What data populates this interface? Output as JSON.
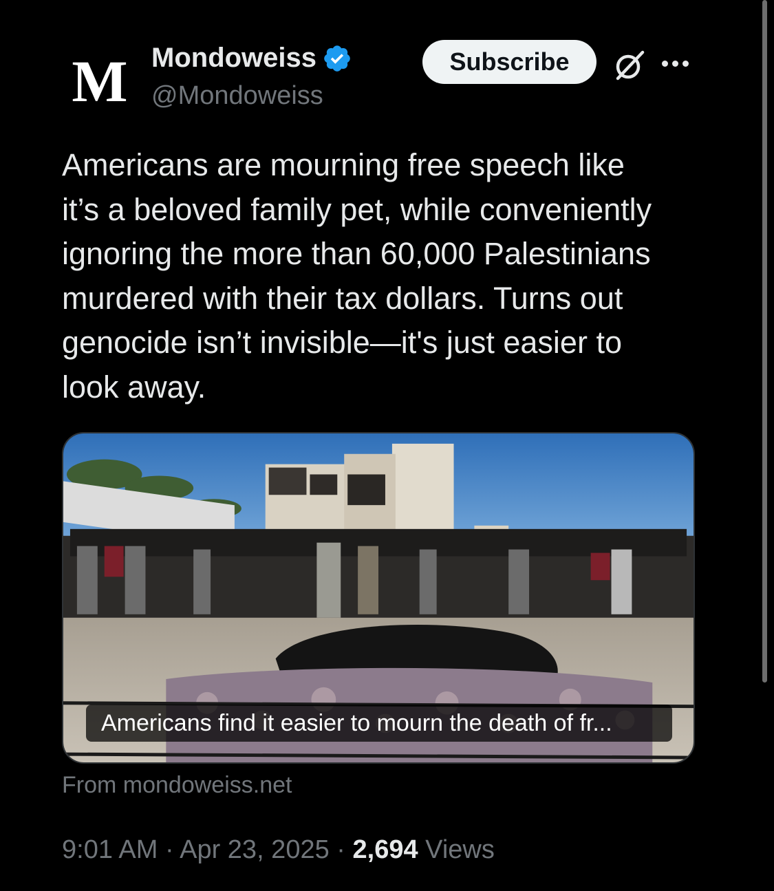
{
  "author": {
    "avatar_letter": "M",
    "display_name": "Mondoweiss",
    "handle": "@Mondoweiss",
    "verified_color": "#1d9bf0"
  },
  "actions": {
    "subscribe_label": "Subscribe",
    "grok_icon": "grok-icon",
    "more_icon": "more-icon"
  },
  "tweet": {
    "text": "Americans are mourning free speech like\nit’s a beloved family pet, while conveniently\nignoring the more than 60,000 Palestinians\nmurdered with their tax dollars. Turns out\ngenocide isn’t invisible—it's just easier to\nlook away."
  },
  "card": {
    "caption": "Americans find it easier to mourn the death of fr...",
    "source": "From mondoweiss.net"
  },
  "meta": {
    "time": "9:01 AM",
    "separator": "·",
    "date": "Apr 23, 2025",
    "views_count": "2,694",
    "views_label": "Views"
  },
  "colors": {
    "background": "#000000",
    "text_primary": "#e7e9ea",
    "text_secondary": "#71767b",
    "button_bg": "#eff3f4"
  }
}
